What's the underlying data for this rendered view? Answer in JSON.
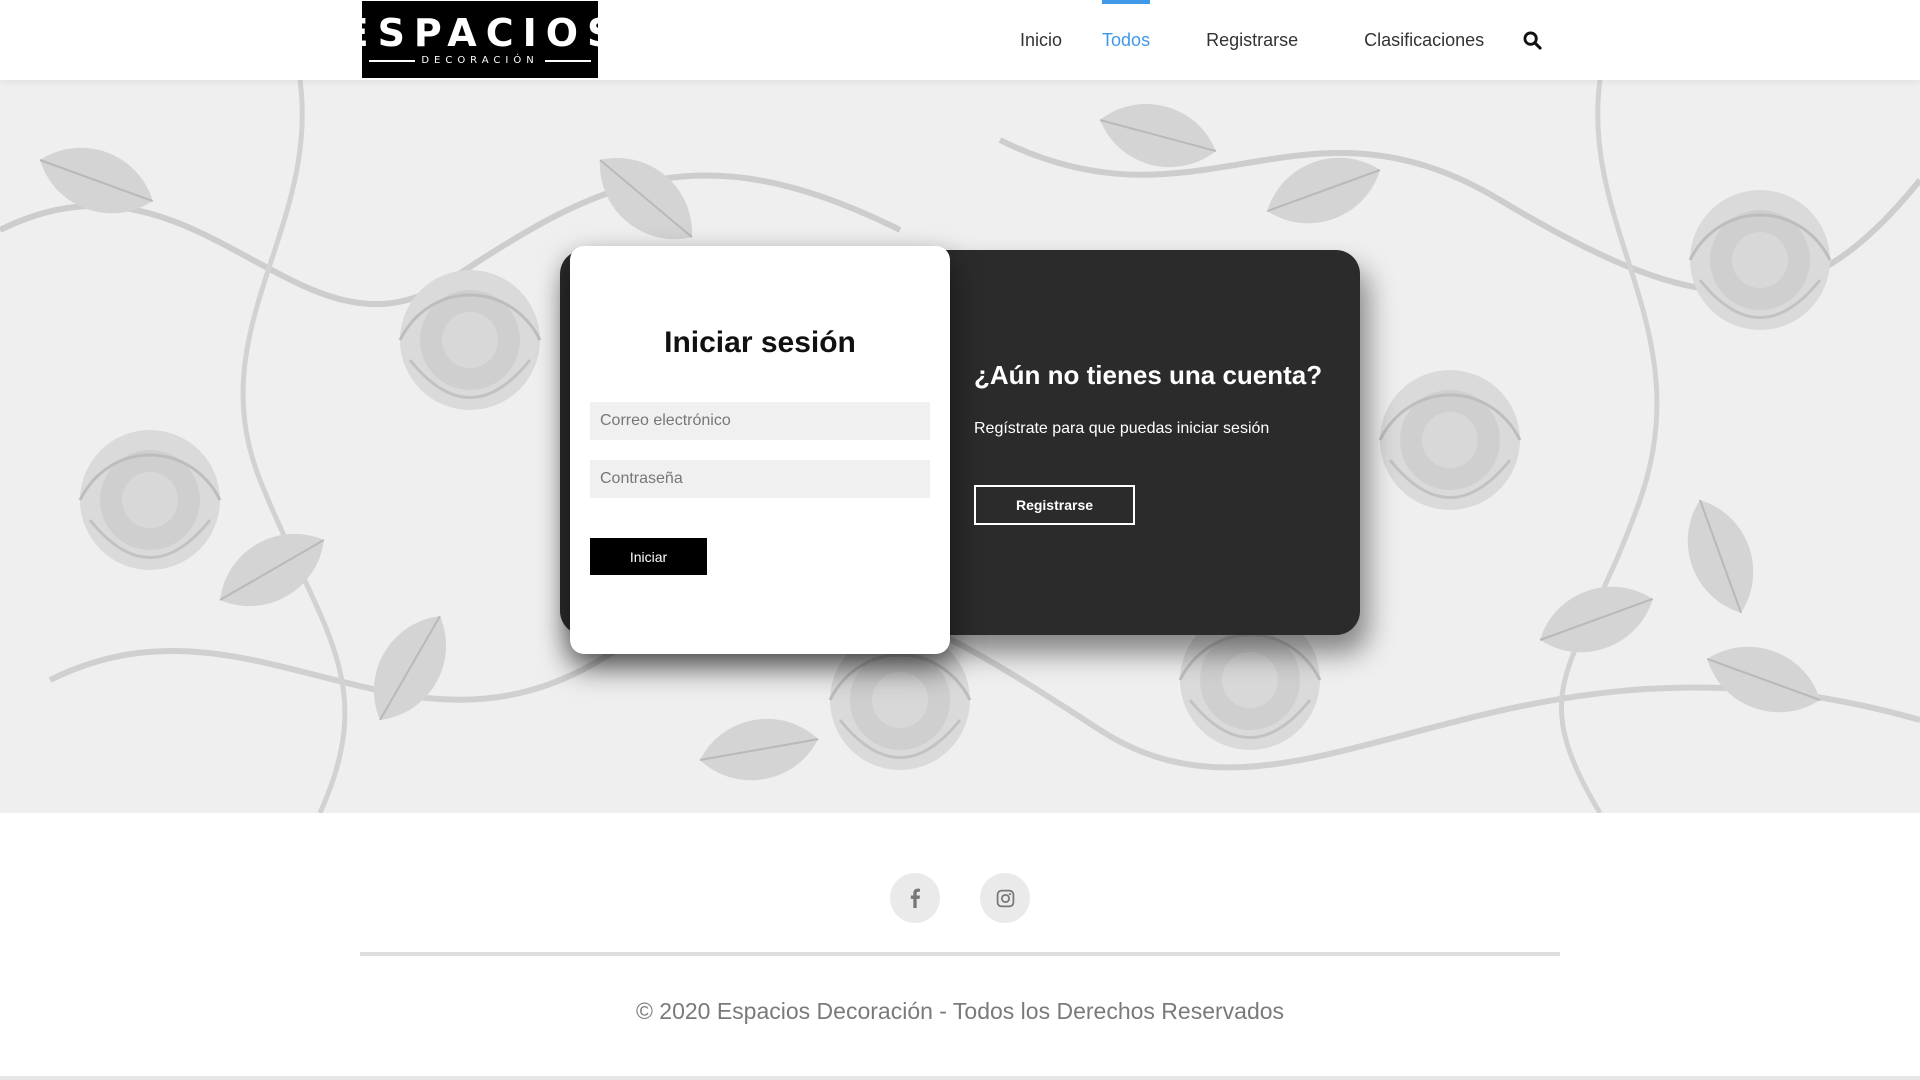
{
  "brand": {
    "name": "ESPACIOS",
    "tagline": "DECORACIÓN"
  },
  "nav": {
    "items": [
      {
        "label": "Inicio",
        "active": false
      },
      {
        "label": "Todos",
        "active": true
      },
      {
        "label": "Registrarse",
        "active": false
      },
      {
        "label": "Clasificaciones",
        "active": false
      }
    ],
    "search_icon": "search-icon"
  },
  "login": {
    "title": "Iniciar sesión",
    "email_placeholder": "Correo electrónico",
    "password_placeholder": "Contraseña",
    "submit_label": "Iniciar"
  },
  "signup": {
    "title": "¿Aún no tienes una cuenta?",
    "text": "Regístrate para que puedas iniciar sesión",
    "button_label": "Registrarse"
  },
  "footer": {
    "social": [
      {
        "name": "facebook-icon"
      },
      {
        "name": "instagram-icon"
      }
    ],
    "copyright": "© 2020 Espacios Decoración - Todos los Derechos Reservados"
  },
  "colors": {
    "accent": "#3f98e8",
    "dark_card": "#2b2b2b",
    "logo_bg": "#000000"
  }
}
